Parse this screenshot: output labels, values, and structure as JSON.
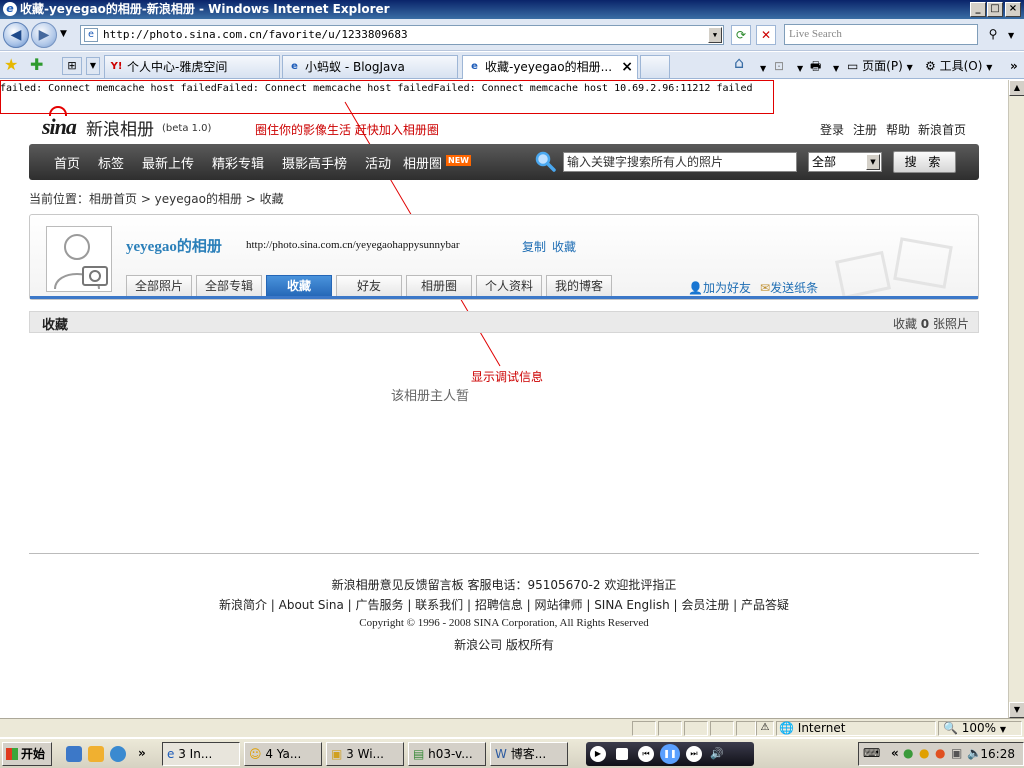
{
  "window": {
    "title": "收藏-yeyegao的相册-新浪相册 - Windows Internet Explorer",
    "minimize": "_",
    "maximize": "□",
    "close": "×"
  },
  "address": {
    "url": "http://photo.sina.com.cn/favorite/u/1233809683",
    "search_placeholder": "Live Search"
  },
  "tabs": [
    {
      "label": "个人中心-雅虎空间",
      "icon": "yahoo-icon"
    },
    {
      "label": "小蚂蚁 - BlogJava",
      "icon": "ie-icon"
    },
    {
      "label": "收藏-yeyegao的相册...",
      "icon": "ie-icon",
      "active": true
    }
  ],
  "toolbar": {
    "page_label": "页面(P)",
    "tools_label": "工具(O)"
  },
  "debug": {
    "text": "failed: Connect memcache host failedFailed: Connect memcache host failedFailed: Connect memcache host 10.69.2.96:11212 failed"
  },
  "site": {
    "logo_text": "sina",
    "logo_cn": "新浪相册",
    "beta": "(beta 1.0)",
    "slogan": "圈住你的影像生活 赶快加入相册圈",
    "top_links": [
      "登录",
      "注册",
      "帮助",
      "新浪首页"
    ]
  },
  "nav": {
    "items": [
      "首页",
      "标签",
      "最新上传",
      "精彩专辑",
      "摄影高手榜",
      "活动",
      "相册圈"
    ],
    "new_badge": "NEW",
    "search_placeholder": "输入关键字搜索所有人的照片",
    "select_value": "全部",
    "search_button": "搜 索"
  },
  "breadcrumb": {
    "text": "当前位置：相册首页 > yeyegao的相册 > 收藏"
  },
  "profile": {
    "username": "yeyegao的相册",
    "url": "http://photo.sina.com.cn/yeyegaohappysunnybar",
    "copy_label": "复制",
    "fav_label": "收藏",
    "tabs": [
      "全部照片",
      "全部专辑",
      "收藏",
      "好友",
      "相册圈",
      "个人资料",
      "我的博客"
    ],
    "add_friend": "加为好友",
    "send_note": "发送纸条"
  },
  "section": {
    "title": "收藏",
    "count_prefix": "收藏",
    "count": "0",
    "count_suffix": "张照片"
  },
  "annotation": {
    "text": "显示调试信息",
    "color": "#cc0000"
  },
  "empty_message": "该相册主人暂",
  "footer": {
    "line1": "新浪相册意见反馈留言板  客服电话：95105670-2  欢迎批评指正",
    "line2": "新浪简介 | About Sina | 广告服务 | 联系我们 | 招聘信息 | 网站律师 | SINA English | 会员注册 | 产品答疑",
    "line3": "Copyright © 1996 - 2008 SINA Corporation, All Rights Reserved",
    "line4": "新浪公司  版权所有"
  },
  "statusbar": {
    "zone": "Internet",
    "zoom": "100%"
  },
  "taskbar": {
    "start": "开始",
    "tasks": [
      "3 In...",
      "4 Ya...",
      "3 Wi...",
      "h03-v...",
      "博客..."
    ],
    "clock": "16:28"
  },
  "colors": {
    "accent_blue": "#2a7fb9",
    "nav_dark": "#3a3a3a",
    "tab_active": "#2466b6",
    "red": "#cc0000"
  }
}
